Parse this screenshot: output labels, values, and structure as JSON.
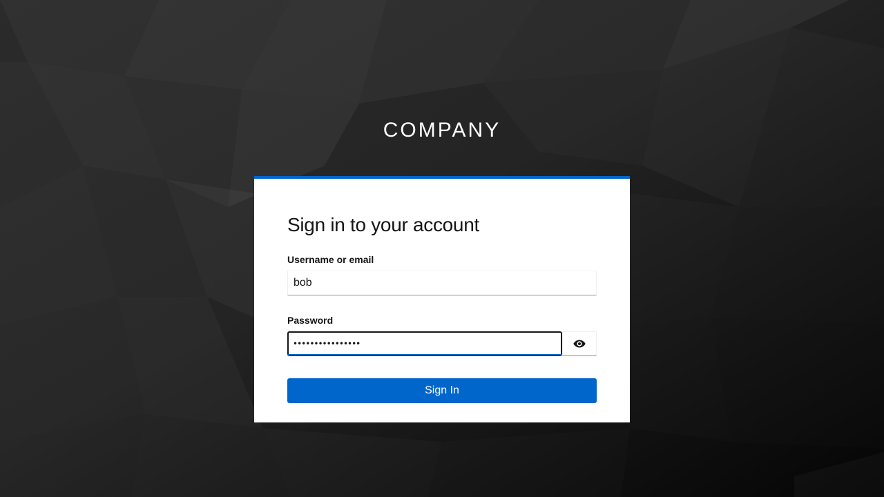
{
  "brand": {
    "name": "COMPANY"
  },
  "login": {
    "title": "Sign in to your account",
    "username": {
      "label": "Username or email",
      "value": "bob"
    },
    "password": {
      "label": "Password",
      "value": "••••••••••••••••",
      "reveal_icon": "eye-icon"
    },
    "submit_label": "Sign In"
  },
  "colors": {
    "accent": "#0066cc",
    "background": "#1c1c1c",
    "card": "#ffffff",
    "text": "#151515"
  }
}
